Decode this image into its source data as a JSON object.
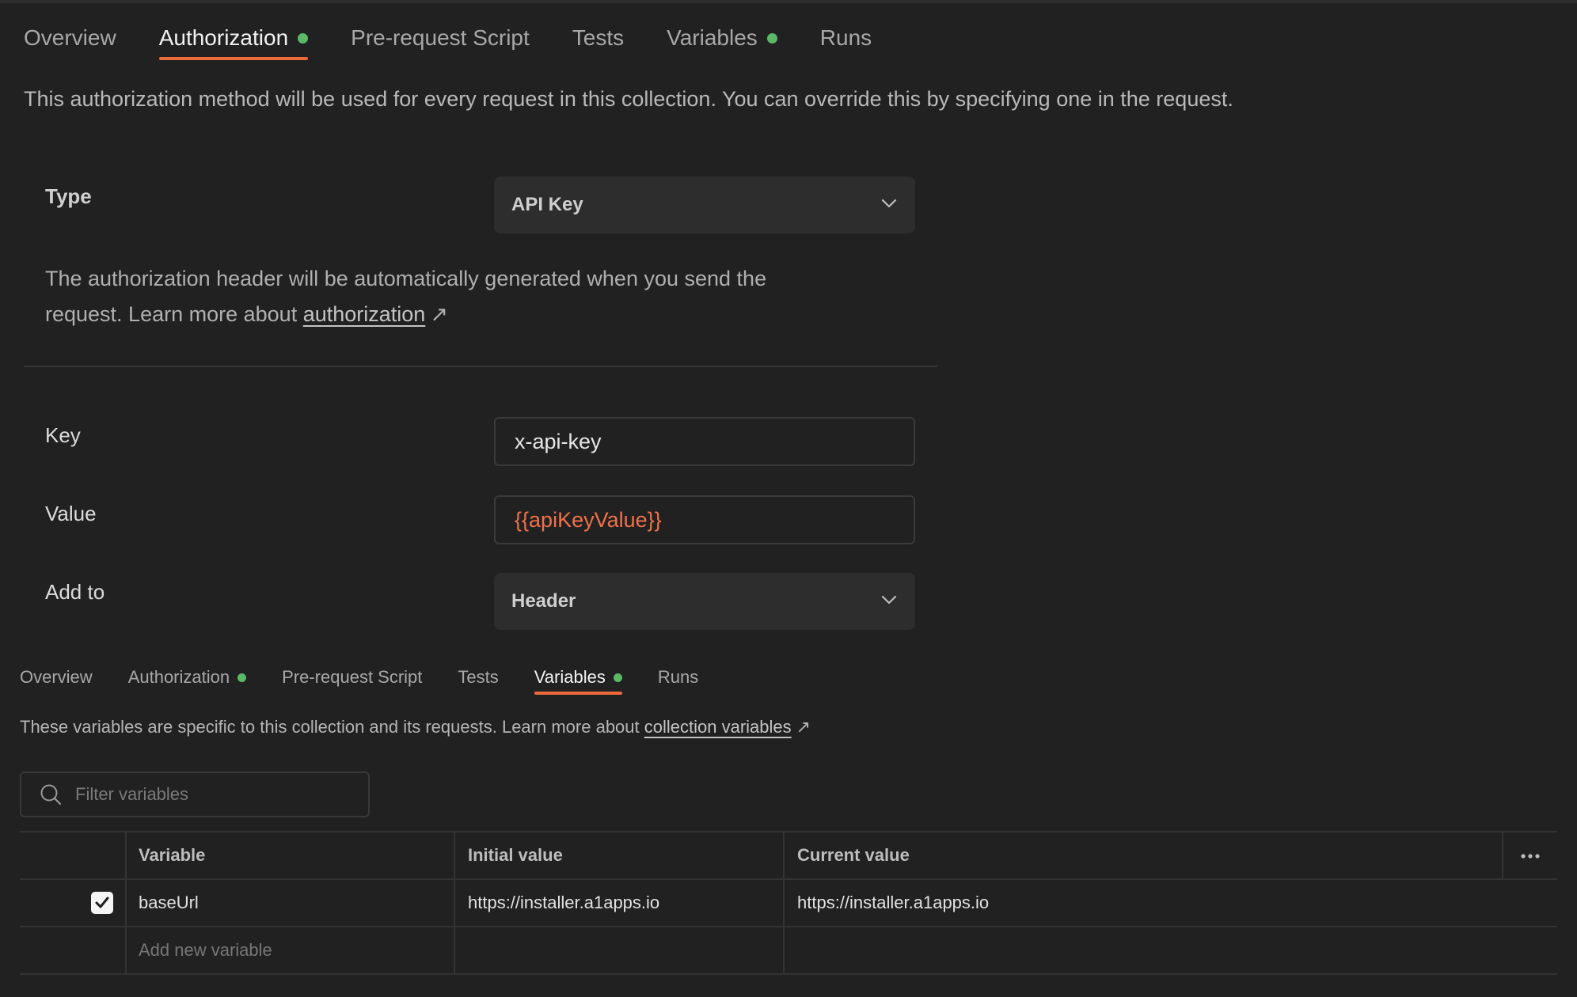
{
  "top_tabs": [
    {
      "label": "Overview",
      "active": false,
      "dot": false
    },
    {
      "label": "Authorization",
      "active": true,
      "dot": true
    },
    {
      "label": "Pre-request Script",
      "active": false,
      "dot": false
    },
    {
      "label": "Tests",
      "active": false,
      "dot": false
    },
    {
      "label": "Variables",
      "active": false,
      "dot": true
    },
    {
      "label": "Runs",
      "active": false,
      "dot": false
    }
  ],
  "auth": {
    "description": "This authorization method will be used for every request in this collection. You can override this by specifying one in the request.",
    "type_label": "Type",
    "type_value": "API Key",
    "help_text": "The authorization header will be automatically generated when you send the request. Learn more about ",
    "help_link": "authorization",
    "link_arrow": "↗",
    "key_label": "Key",
    "key_value": "x-api-key",
    "value_label": "Value",
    "value_value": "{{apiKeyValue}}",
    "addto_label": "Add to",
    "addto_value": "Header"
  },
  "second_tabs": [
    {
      "label": "Overview",
      "active": false,
      "dot": false
    },
    {
      "label": "Authorization",
      "active": false,
      "dot": true
    },
    {
      "label": "Pre-request Script",
      "active": false,
      "dot": false
    },
    {
      "label": "Tests",
      "active": false,
      "dot": false
    },
    {
      "label": "Variables",
      "active": true,
      "dot": true
    },
    {
      "label": "Runs",
      "active": false,
      "dot": false
    }
  ],
  "variables": {
    "description": "These variables are specific to this collection and its requests. Learn more about ",
    "link": "collection variables",
    "link_arrow": "↗",
    "filter_placeholder": "Filter variables",
    "columns": {
      "variable": "Variable",
      "initial": "Initial value",
      "current": "Current value"
    },
    "rows": [
      {
        "checked": true,
        "variable": "baseUrl",
        "initial": "https://installer.a1apps.io",
        "current": "https://installer.a1apps.io"
      }
    ],
    "add_placeholder": "Add new variable"
  },
  "colors": {
    "accent": "#ec6b3d",
    "dot": "#5ab867",
    "variable_text": "#f0714a",
    "background": "#212121"
  }
}
